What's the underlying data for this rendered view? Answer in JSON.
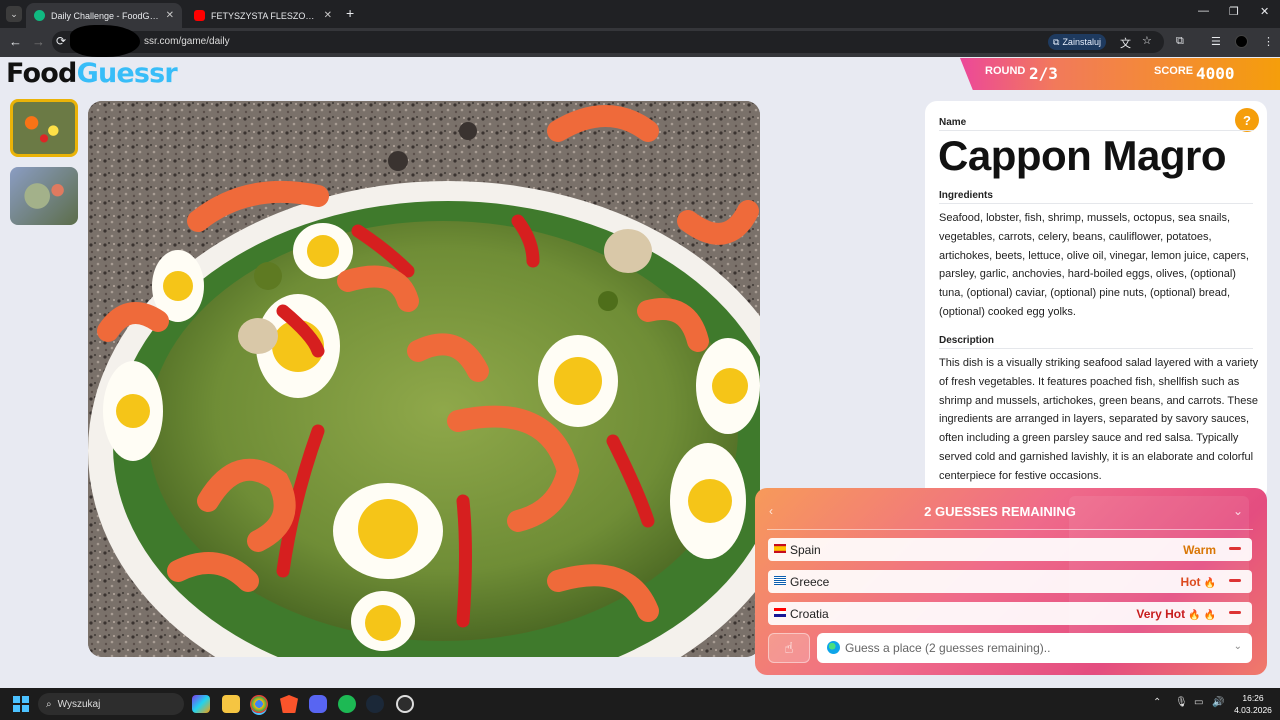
{
  "browser": {
    "tabs": [
      {
        "title": "Daily Challenge - FoodGuessr |",
        "favicon_color": "#10b981"
      },
      {
        "title": "FETYSZYSTA FLESZOWY | CZY M",
        "favicon_color": "#ff0000"
      }
    ],
    "url": "ssr.com/game/daily",
    "install_label": "Zainstaluj"
  },
  "logo": {
    "part1": "Food",
    "part2": "Guessr"
  },
  "status": {
    "round_label": "ROUND",
    "round_value": "2/3",
    "score_label": "SCORE",
    "score_value": "4000"
  },
  "info": {
    "name_label": "Name",
    "name": "Cappon Magro",
    "ingredients_label": "Ingredients",
    "ingredients": "Seafood, lobster, fish, shrimp, mussels, octopus, sea snails, vegetables, carrots, celery, beans, cauliflower, potatoes, artichokes, beets, lettuce, olive oil, vinegar, lemon juice, capers, parsley, garlic, anchovies, hard-boiled eggs, olives, (optional) tuna, (optional) caviar, (optional) pine nuts, (optional) bread, (optional) cooked egg yolks.",
    "description_label": "Description",
    "description": "This dish is a visually striking seafood salad layered with a variety of fresh vegetables. It features poached fish, shellfish such as shrimp and mussels, artichokes, green beans, and carrots. These ingredients are arranged in layers, separated by savory sauces, often including a green parsley sauce and red salsa. Typically served cold and garnished lavishly, it is an elaborate and colorful centerpiece for festive occasions."
  },
  "guesses": {
    "title": "2 GUESSES REMAINING",
    "items": [
      {
        "country": "Spain",
        "temp": "Warm",
        "color": "#d97706"
      },
      {
        "country": "Greece",
        "temp": "Hot",
        "color": "#dc4a1f"
      },
      {
        "country": "Croatia",
        "temp": "Very Hot",
        "color": "#c81e1e"
      }
    ],
    "input_placeholder": "Guess a place (2 guesses remaining).."
  },
  "taskbar": {
    "search_placeholder": "Wyszukaj",
    "time": "16:26",
    "date": "4.03.2026"
  }
}
